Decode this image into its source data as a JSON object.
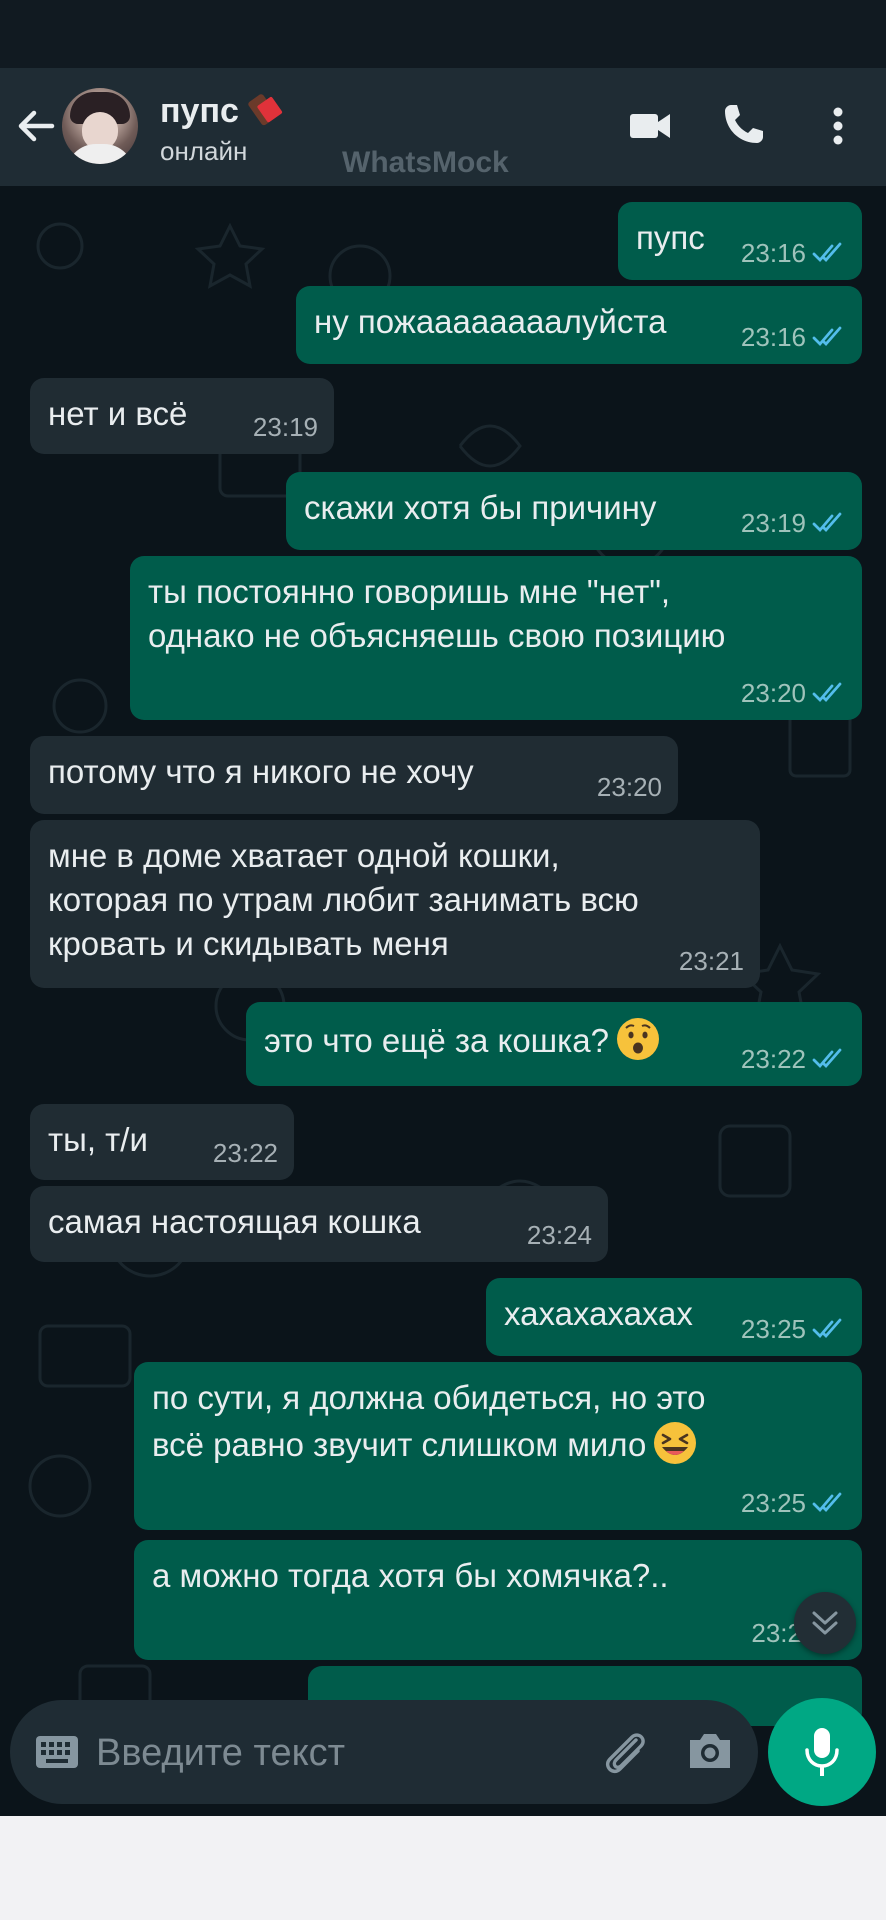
{
  "header": {
    "contact_name": "пупс",
    "status": "онлайн",
    "watermark": "WhatsMock",
    "icons": [
      "back-arrow-icon",
      "video-call-icon",
      "voice-call-icon",
      "more-options-icon"
    ]
  },
  "messages": [
    {
      "dir": "out",
      "text": "пупс",
      "time": "23:16",
      "read": true
    },
    {
      "dir": "out",
      "text": "ну пожаааааааалуйста",
      "time": "23:16",
      "read": true
    },
    {
      "dir": "in",
      "text": "нет и всё",
      "time": "23:19"
    },
    {
      "dir": "out",
      "text": "скажи хотя бы причину",
      "time": "23:19",
      "read": true
    },
    {
      "dir": "out",
      "text": "ты постоянно говоришь мне \"нет\",\nоднако не объясняешь свою позицию",
      "time": "23:20",
      "read": true
    },
    {
      "dir": "in",
      "text": "потому что я никого не хочу",
      "time": "23:20"
    },
    {
      "dir": "in",
      "text": "мне в доме хватает одной кошки,\nкоторая по утрам любит занимать всю\nкровать и скидывать меня",
      "time": "23:21"
    },
    {
      "dir": "out",
      "text": "это что ещё за кошка?",
      "emoji": "hushed-face-emoji",
      "time": "23:22",
      "read": true
    },
    {
      "dir": "in",
      "text": "ты, т/и",
      "time": "23:22"
    },
    {
      "dir": "in",
      "text": "самая настоящая кошка",
      "time": "23:24"
    },
    {
      "dir": "out",
      "text": "хахахахахах",
      "time": "23:25",
      "read": true
    },
    {
      "dir": "out",
      "text": "по сути, я должна обидеться, но это\nвсё равно звучит слишком мило",
      "emoji": "laughing-face-emoji",
      "time": "23:25",
      "read": true
    },
    {
      "dir": "out",
      "text": "а можно тогда хотя бы хомячка?..",
      "time": "23:2"
    }
  ],
  "composer": {
    "placeholder": "Введите текст"
  },
  "colors": {
    "header_bg": "#1f2c34",
    "chat_bg": "#0b141a",
    "incoming_bubble": "#202c33",
    "outgoing_bubble": "#005c4b",
    "read_ticks": "#53bdeb",
    "mic_button": "#00a884"
  }
}
